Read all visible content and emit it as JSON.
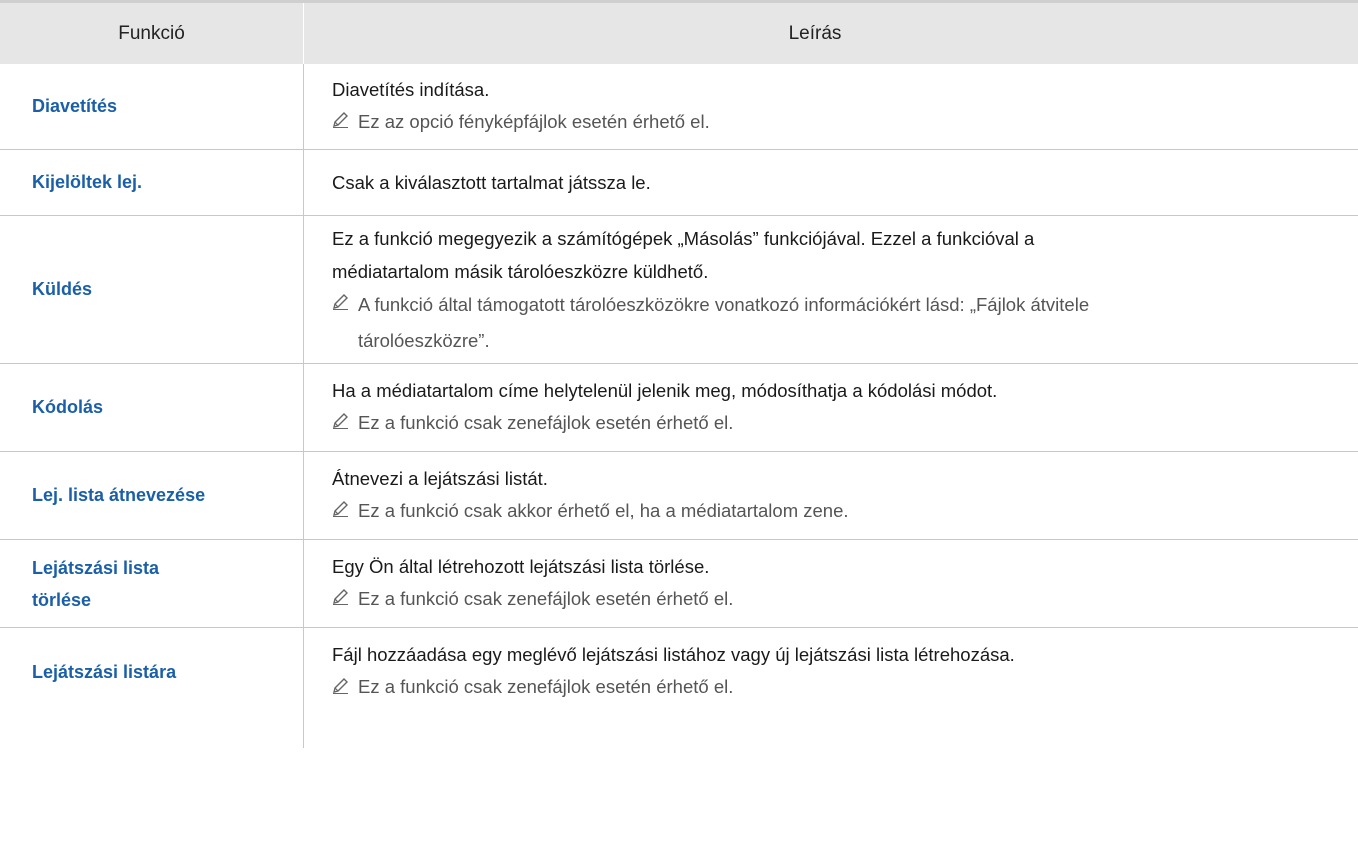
{
  "header": {
    "col1": "Funkció",
    "col2": "Leírás"
  },
  "rows": [
    {
      "function": "Diavetítés",
      "description": "Diavetítés indítása.",
      "note": "Ez az opció fényképfájlok esetén érhető el."
    },
    {
      "function": "Kijelöltek lej.",
      "description": "Csak a kiválasztott tartalmat játssza le.",
      "note": ""
    },
    {
      "function": "Küldés",
      "description_lines": [
        "Ez a funkció megegyezik a számítógépek „Másolás” funkciójával. Ezzel a funkcióval a",
        "médiatartalom másik tárolóeszközre küldhető."
      ],
      "note_lines": [
        "A funkció által támogatott tárolóeszközökre vonatkozó információkért lásd: „Fájlok átvitele",
        "tárolóeszközre”."
      ]
    },
    {
      "function": "Kódolás",
      "description": "Ha a médiatartalom címe helytelenül jelenik meg, módosíthatja a kódolási módot.",
      "note": "Ez a funkció csak zenefájlok esetén érhető el."
    },
    {
      "function": "Lej. lista átnevezése",
      "description": "Átnevezi a lejátszási listát.",
      "note": "Ez a funkció csak akkor érhető el, ha a médiatartalom zene."
    },
    {
      "function_lines": [
        "Lejátszási lista",
        "törlése"
      ],
      "description": "Egy Ön által létrehozott lejátszási lista törlése.",
      "note": "Ez a funkció csak zenefájlok esetén érhető el."
    },
    {
      "function": "Lejátszási listára",
      "description": "Fájl hozzáadása egy meglévő lejátszási listához vagy új lejátszási lista létrehozása.",
      "note": "Ez a funkció csak zenefájlok esetén érhető el."
    }
  ],
  "icons": {
    "note_icon": "pencil-icon"
  },
  "colors": {
    "function_text": "#1a5fa8",
    "header_bg": "#e6e6e6",
    "border": "#c8c8c8"
  }
}
